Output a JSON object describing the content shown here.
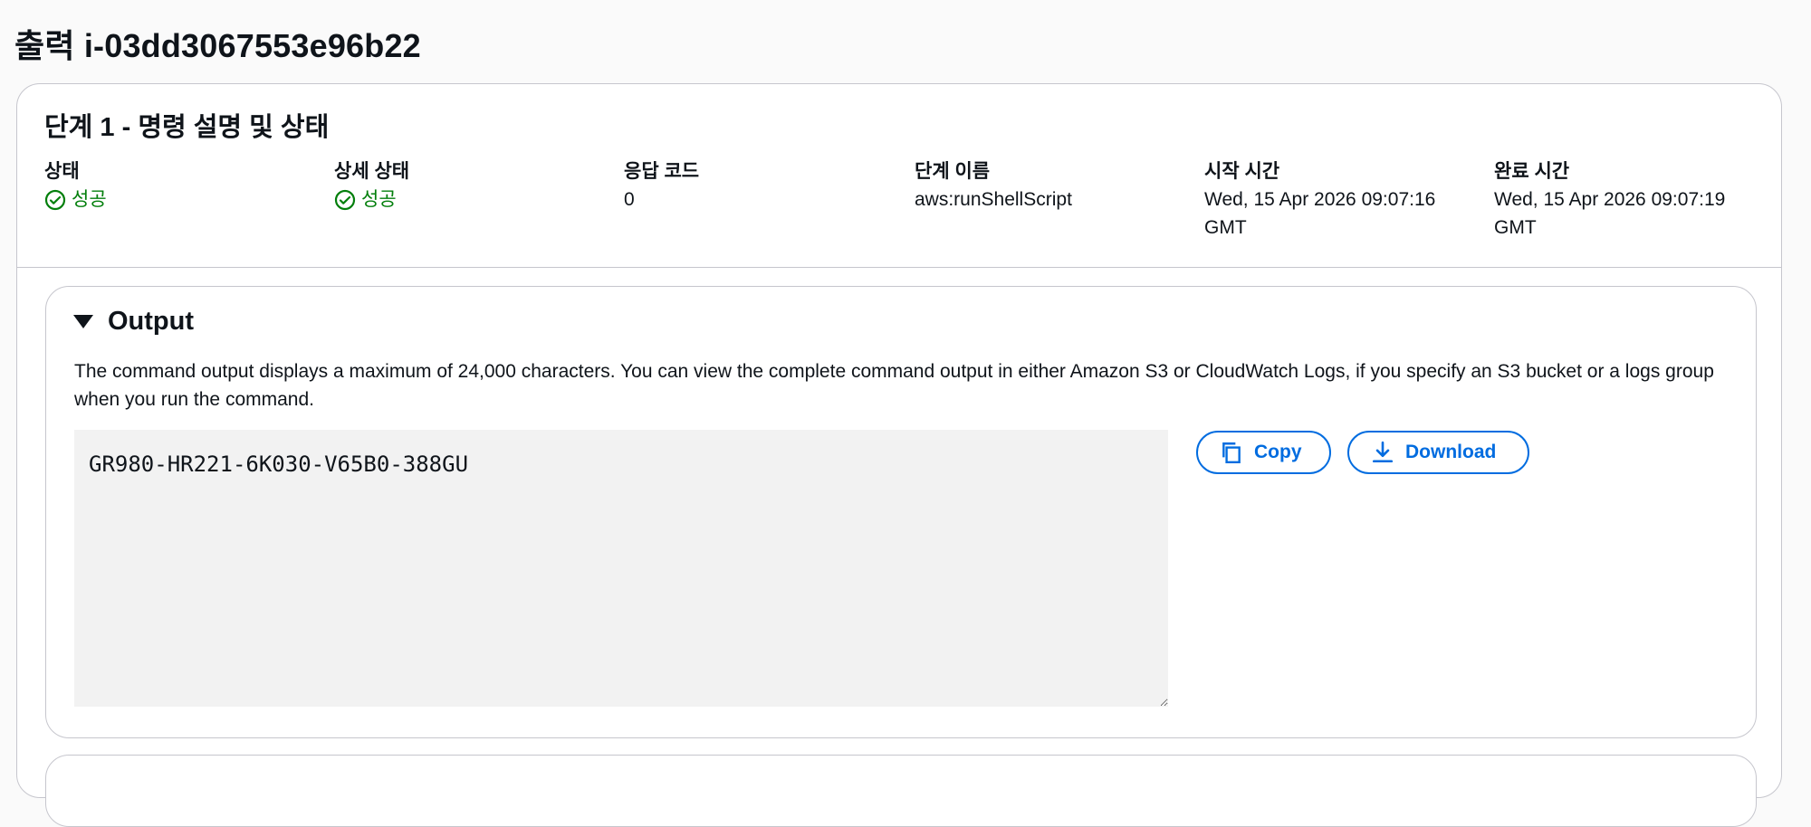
{
  "page": {
    "title": "출력 i-03dd3067553e96b22"
  },
  "step": {
    "title": "단계 1 - 명령 설명 및 상태",
    "fields": {
      "status_label": "상태",
      "status_value": "성공",
      "detailed_status_label": "상세 상태",
      "detailed_status_value": "성공",
      "response_code_label": "응답 코드",
      "response_code_value": "0",
      "step_name_label": "단계 이름",
      "step_name_value": "aws:runShellScript",
      "start_time_label": "시작 시간",
      "start_time_value": "Wed, 15 Apr 2026 09:07:16 GMT",
      "end_time_label": "완료 시간",
      "end_time_value": "Wed, 15 Apr 2026 09:07:19 GMT"
    },
    "status_color": "#037f0c"
  },
  "output": {
    "title": "Output",
    "description": "The command output displays a maximum of 24,000 characters. You can view the complete command output in either Amazon S3 or CloudWatch Logs, if you specify an S3 bucket or a logs group when you run the command.",
    "text": "GR980-HR221-6K030-V65B0-388GU",
    "copy_label": "Copy",
    "download_label": "Download",
    "accent_color": "#006ce0"
  },
  "icons": {
    "status": "check-circle-icon",
    "copy": "copy-icon",
    "download": "download-icon",
    "expand": "caret-down-icon"
  }
}
